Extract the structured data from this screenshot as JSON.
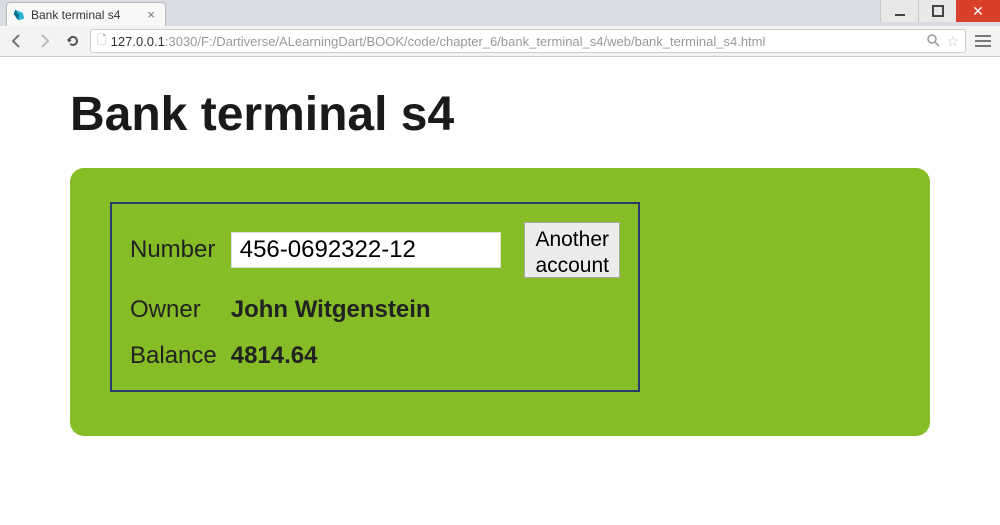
{
  "browser": {
    "tab_title": "Bank terminal s4",
    "url_host": "127.0.0.1",
    "url_port": ":3030",
    "url_path": "/F:/Dartiverse/ALearningDart/BOOK/code/chapter_6/bank_terminal_s4/web/bank_terminal_s4.html"
  },
  "page": {
    "title": "Bank terminal s4",
    "form": {
      "number_label": "Number",
      "number_value": "456-0692322-12",
      "button_line1": "Another",
      "button_line2": "account",
      "owner_label": "Owner",
      "owner_value": "John Witgenstein",
      "balance_label": "Balance",
      "balance_value": "4814.64"
    }
  }
}
